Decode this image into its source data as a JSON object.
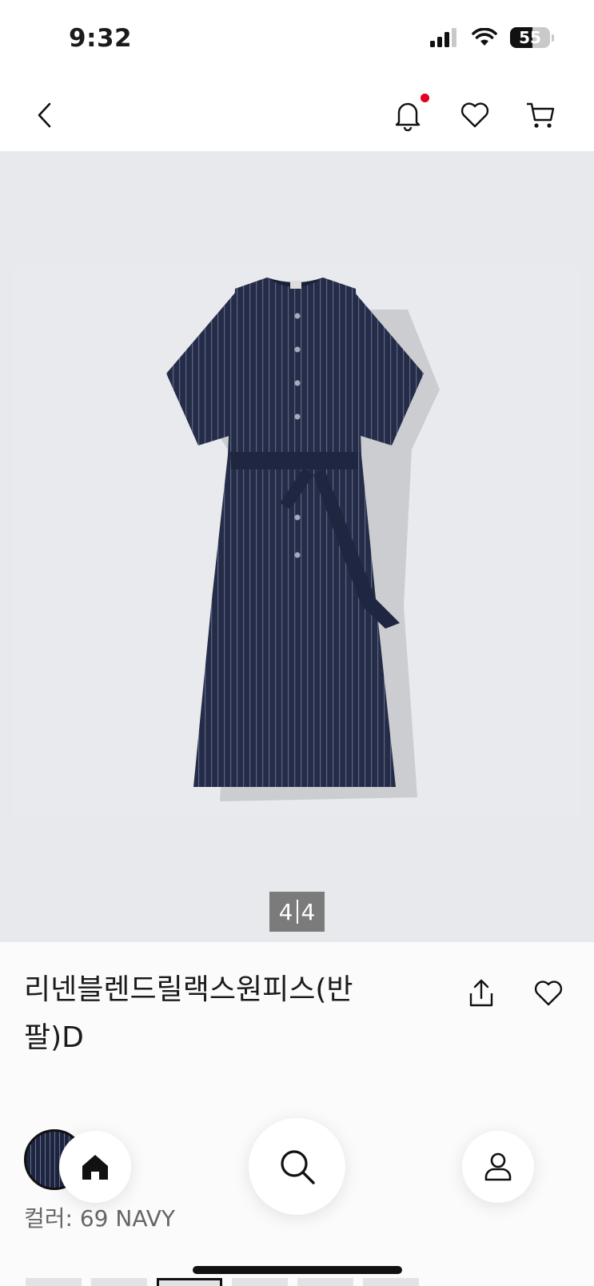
{
  "status_bar": {
    "time": "9:32",
    "battery": "55",
    "battery_level": 0.55
  },
  "nav": {
    "notification_badge": true
  },
  "gallery": {
    "current": "4",
    "total": "4"
  },
  "product": {
    "title": "리넨블렌드릴랙스원피스(반팔)D",
    "color_label": "컬러: 69 NAVY"
  },
  "colors": {
    "accent_red": "#e6001f",
    "navy": "#1d2540"
  },
  "bottom_nav": [
    "home-icon",
    "search-icon",
    "user-icon"
  ]
}
